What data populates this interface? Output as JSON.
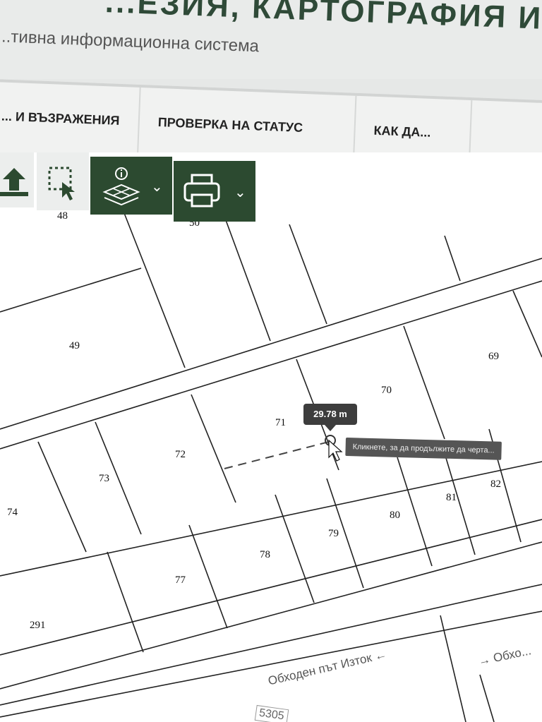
{
  "header": {
    "title": "...ЕЗИЯ, КАРТОГРАФИЯ И КАДАСТ...",
    "subtitle": "...тивна информационна система"
  },
  "nav": {
    "items": [
      {
        "label": "... И ВЪЗРАЖЕНИЯ"
      },
      {
        "label": "ПРОВЕРКА НА СТАТУС"
      },
      {
        "label": "КАК ДА..."
      }
    ]
  },
  "toolbar": {
    "upload_icon": "upload-icon",
    "select_icon": "area-select-icon",
    "info_layers_icon": "info-layers-icon",
    "print_icon": "printer-icon",
    "colors": {
      "dark": "#2c4a30",
      "light": "#eceeed"
    }
  },
  "map": {
    "parcels": [
      "48",
      "50",
      "49",
      "69",
      "70",
      "71",
      "72",
      "73",
      "74",
      "82",
      "81",
      "80",
      "79",
      "78",
      "77",
      "291"
    ],
    "measurement": {
      "value": "29.78 m"
    },
    "hint": "Кликнете, за да продължите да черта...",
    "roads": [
      {
        "label": "Обходен път Изток ←"
      },
      {
        "label": "→ Обхо..."
      }
    ],
    "street_code": "5305"
  }
}
